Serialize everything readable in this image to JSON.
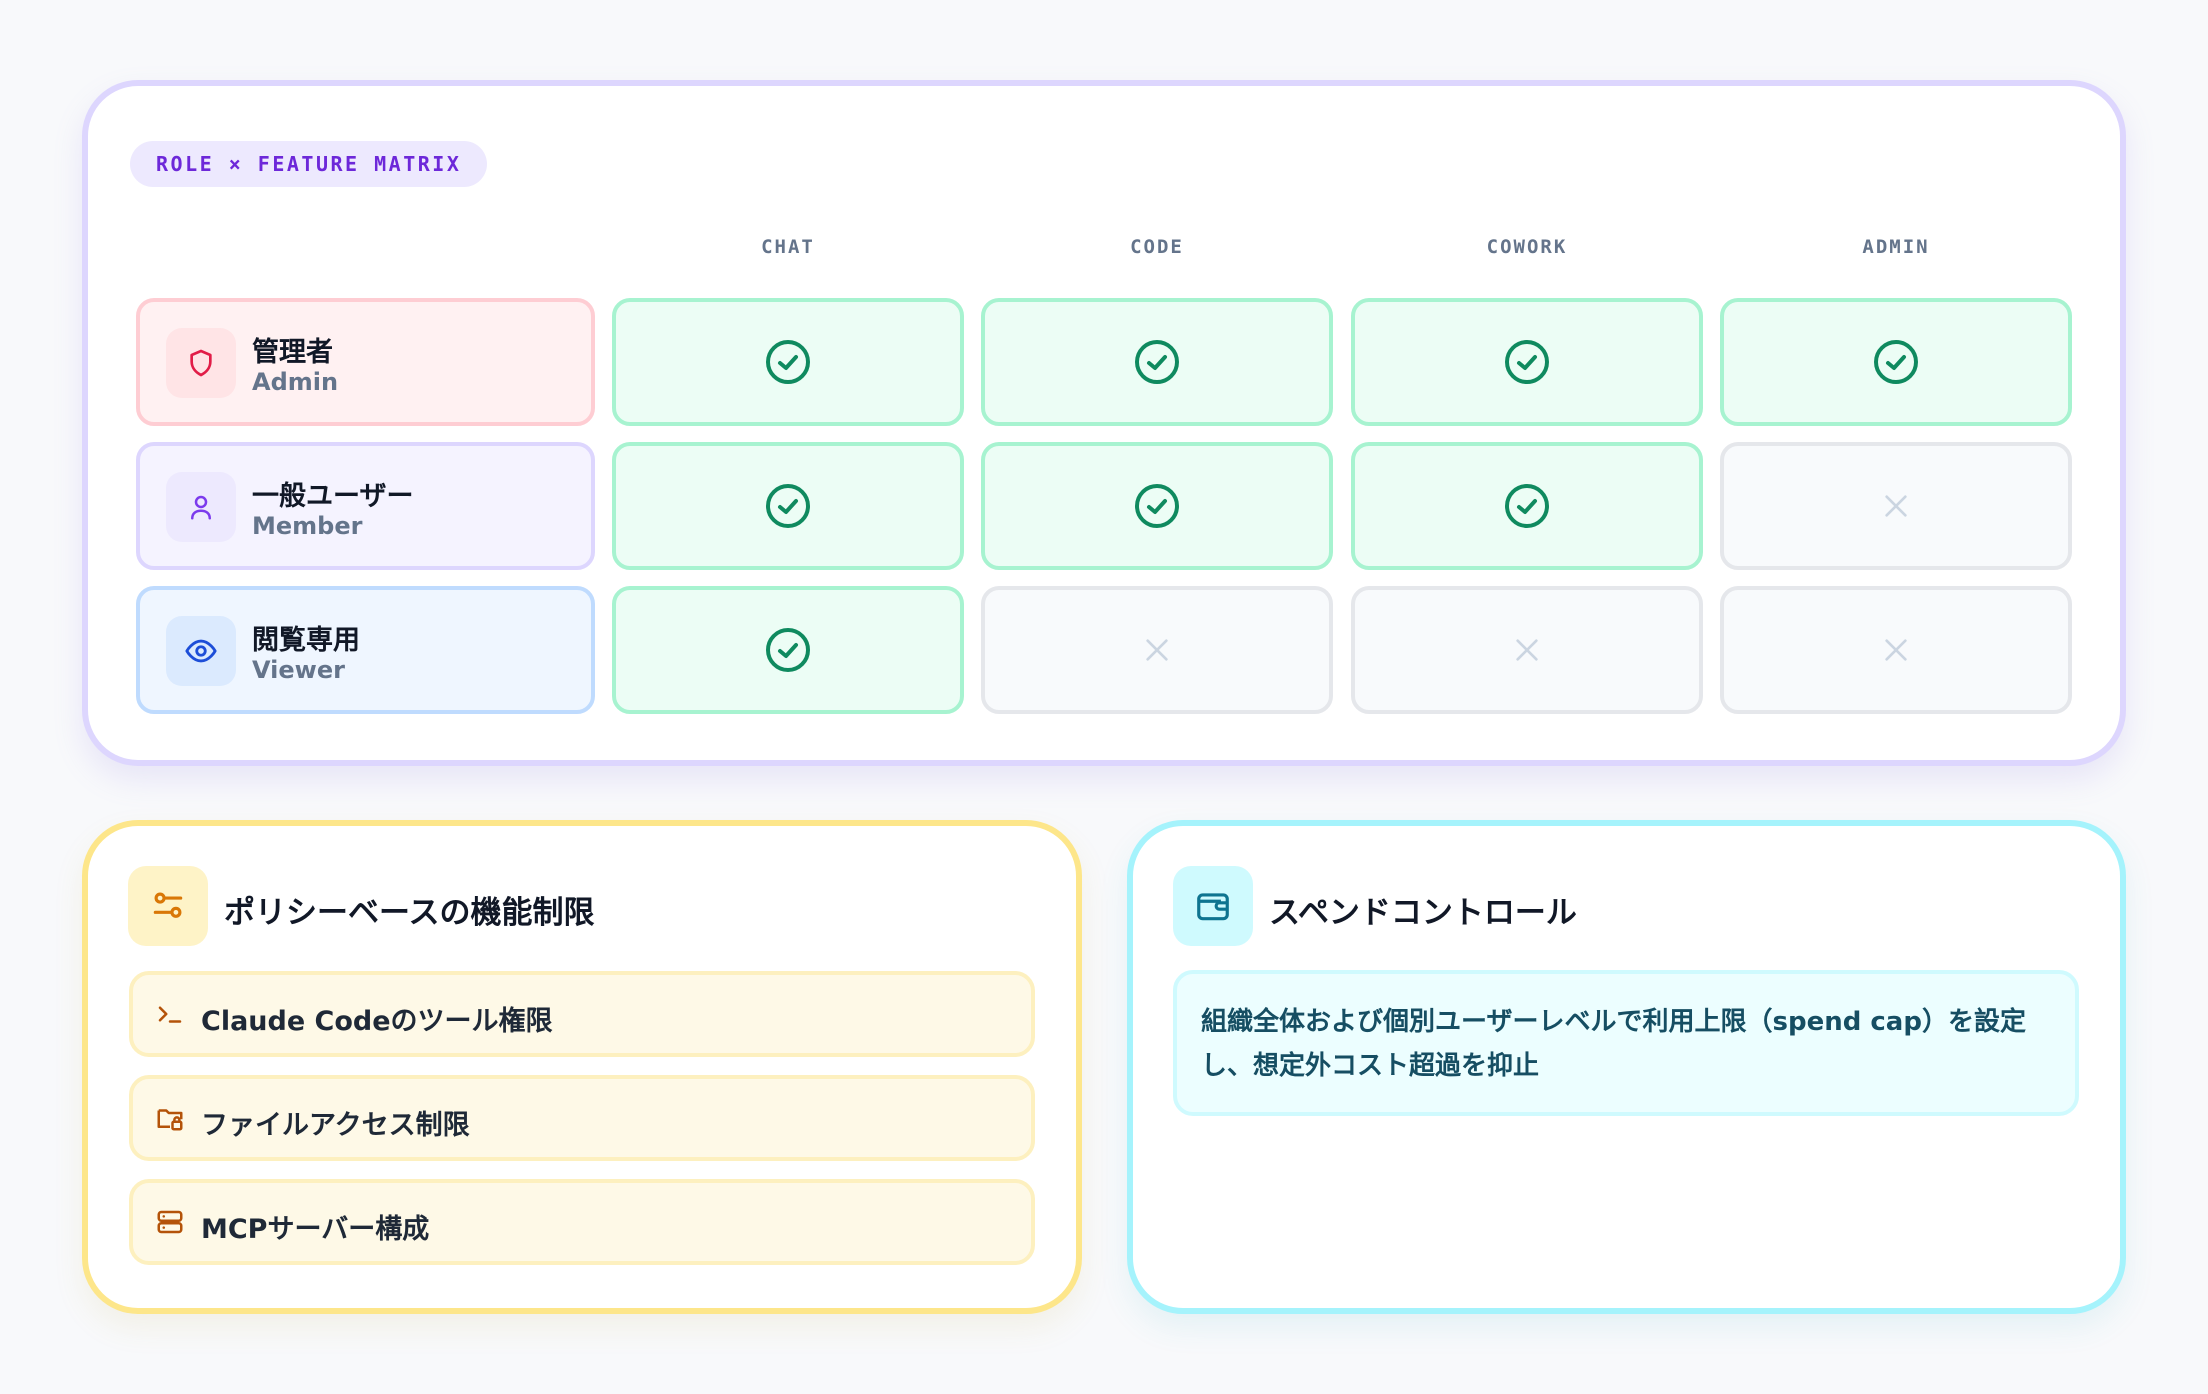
{
  "matrix": {
    "badge": "ROLE × FEATURE MATRIX",
    "columns": [
      "CHAT",
      "CODE",
      "COWORK",
      "ADMIN"
    ],
    "roles": [
      {
        "name_ja": "管理者",
        "name_en": "Admin",
        "icon": "shield-icon",
        "access": [
          true,
          true,
          true,
          true
        ]
      },
      {
        "name_ja": "一般ユーザー",
        "name_en": "Member",
        "icon": "user-icon",
        "access": [
          true,
          true,
          true,
          false
        ]
      },
      {
        "name_ja": "閲覧専用",
        "name_en": "Viewer",
        "icon": "eye-icon",
        "access": [
          true,
          false,
          false,
          false
        ]
      }
    ]
  },
  "policy": {
    "title": "ポリシーベースの機能制限",
    "icon": "sliders-icon",
    "items": [
      {
        "label": "Claude Codeのツール権限",
        "icon": "terminal-icon"
      },
      {
        "label": "ファイルアクセス制限",
        "icon": "folder-lock-icon"
      },
      {
        "label": "MCPサーバー構成",
        "icon": "server-icon"
      }
    ]
  },
  "spend": {
    "title": "スペンドコントロール",
    "icon": "wallet-icon",
    "description": "組織全体および個別ユーザーレベルで利用上限（spend cap）を設定し、想定外コスト超過を抑止"
  },
  "colors": {
    "check": "#0f8a5f",
    "cross": "#cbd5e1",
    "accent_purple": "#6d28d9"
  }
}
